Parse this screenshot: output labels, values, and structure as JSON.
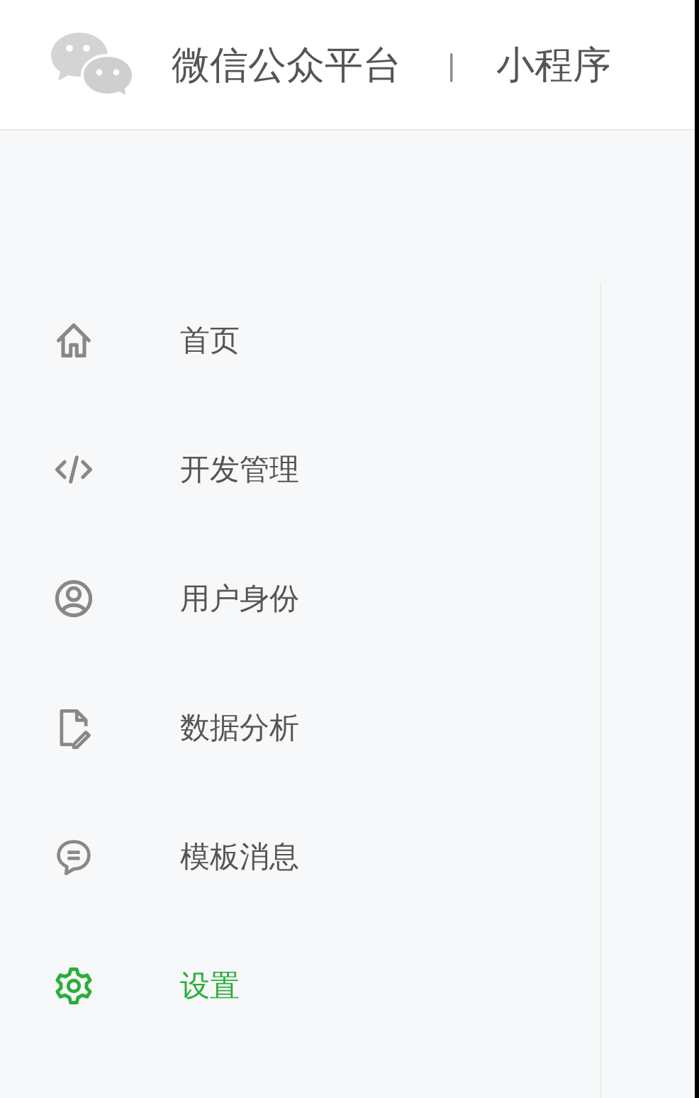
{
  "header": {
    "title": "微信公众平台",
    "separator": "|",
    "product": "小程序"
  },
  "sidebar": {
    "items": [
      {
        "label": "首页",
        "selected": false
      },
      {
        "label": "开发管理",
        "selected": false
      },
      {
        "label": "用户身份",
        "selected": false
      },
      {
        "label": "数据分析",
        "selected": false
      },
      {
        "label": "模板消息",
        "selected": false
      },
      {
        "label": "设置",
        "selected": true
      }
    ]
  }
}
